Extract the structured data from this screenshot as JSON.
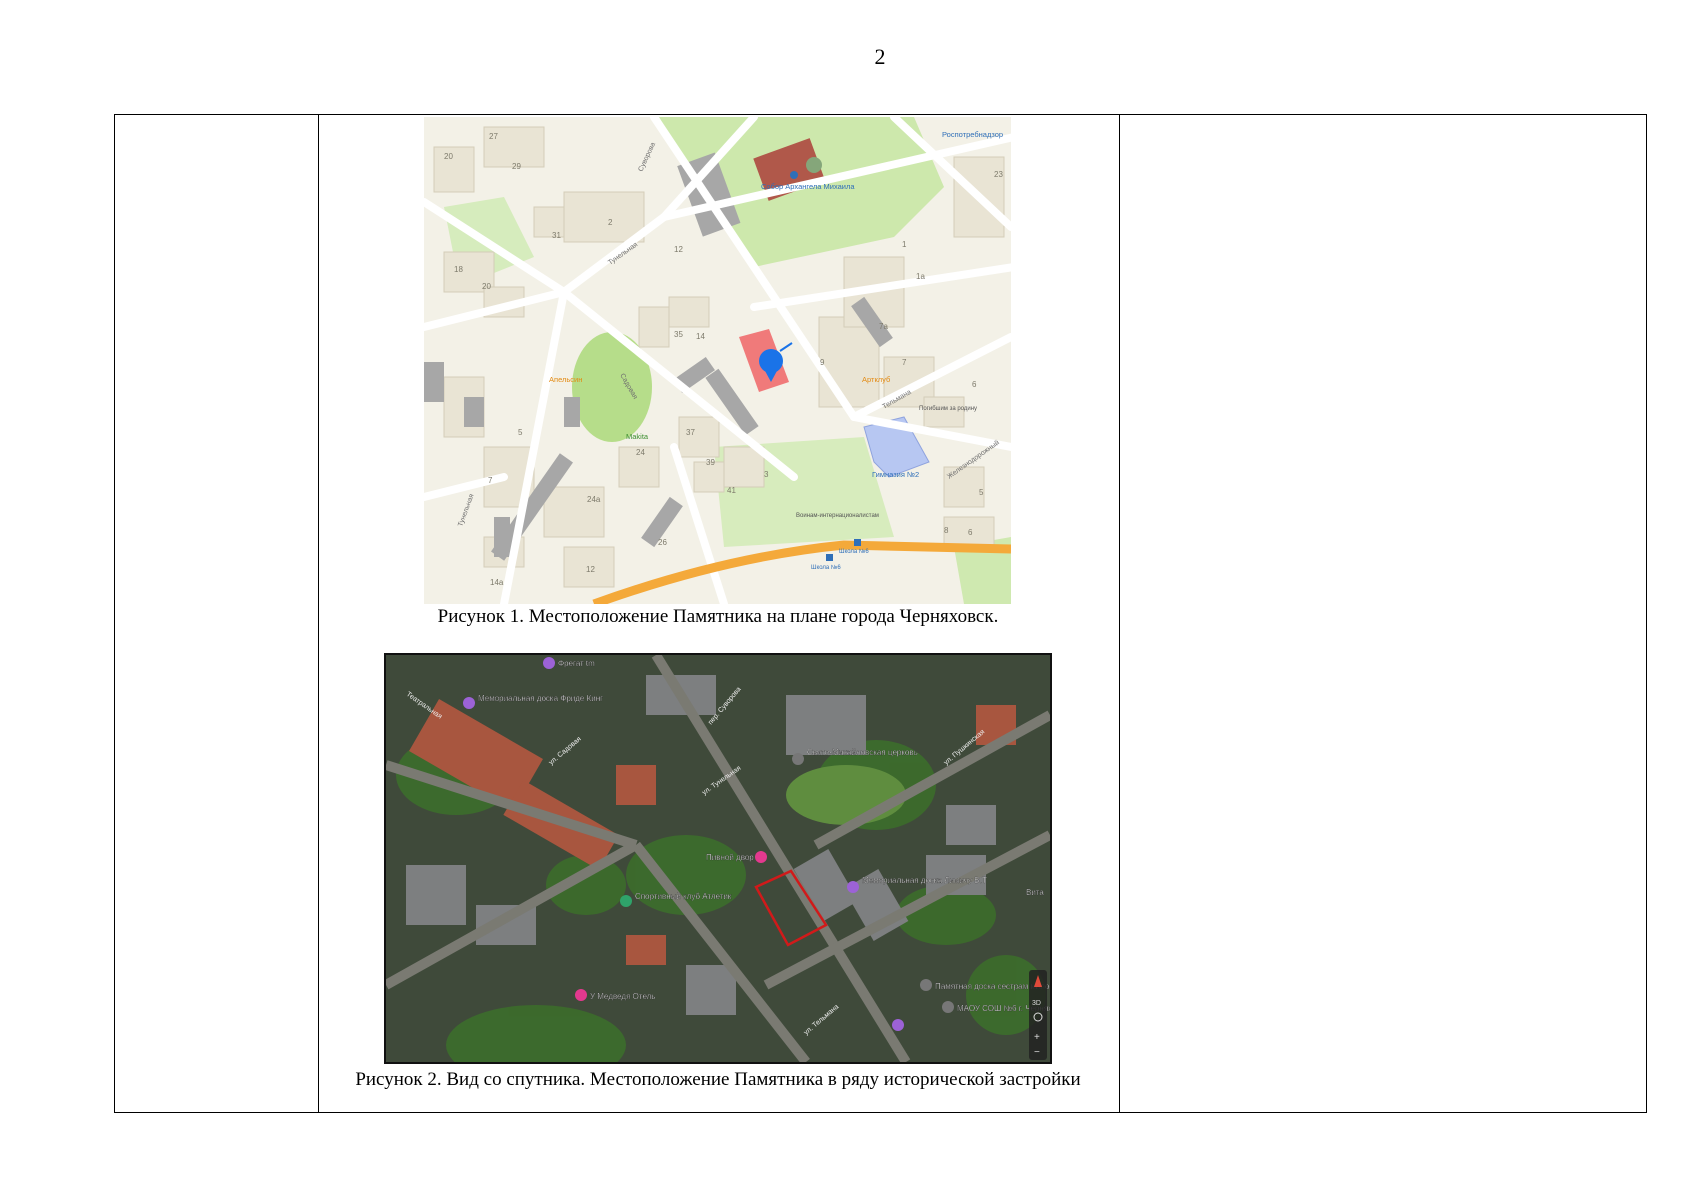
{
  "page": {
    "number": "2"
  },
  "figure1": {
    "caption": "Рисунок 1. Местоположение Памятника на плане города Черняховск.",
    "labels": {
      "cathedral": "Собор Архангела Михаила",
      "rospotreb": "Роспотребнадзор",
      "gymnasium": "Гимназия №2",
      "artclub": "Артклуб",
      "apelsin": "Апельсин",
      "makita": "Makita",
      "warriors": "Воинам-интернационалистам",
      "fallen": "Погибшим за родину",
      "school_stop": "Школа №6",
      "school_stop_2": "Школа №6"
    },
    "streets": {
      "suvorova": "Суворова",
      "tunnelnaya": "Тунельная",
      "sadovaya": "Садовая",
      "telmana": "Тельмана",
      "zheleznodorozhnaya": "Железнодорожный",
      "tunnelnaya_2": "Тунельная"
    },
    "house_numbers": [
      "27",
      "29",
      "20",
      "31",
      "2",
      "12",
      "18",
      "20",
      "35",
      "14",
      "9",
      "1",
      "1а",
      "7а",
      "7",
      "6",
      "37",
      "5",
      "39",
      "3",
      "24",
      "41",
      "24а",
      "7",
      "12",
      "14а",
      "8",
      "6",
      "5",
      "23",
      "26"
    ]
  },
  "figure2": {
    "caption": "Рисунок 2. Вид  со спутника. Местоположение Памятника в ряду исторической застройки",
    "labels": {
      "frigate": "Фрегат tm",
      "memorial_king": "Мемориальная доска Фриде Кинг",
      "church": "Свято-Михайловская церковь",
      "pub": "Пивной двор",
      "sport_club": "Спортивный клуб Атлетик",
      "memorial_lymichu": "Мемориальная доска Лимичу В.Т",
      "hotel": "У Медведя Отель",
      "memorial_sisters": "Памятная доска сестрам милосердия",
      "school": "МАОУ СОШ №6 г. Черняховск",
      "vita": "Вита"
    },
    "streets": {
      "teatralnaya": "Театральная",
      "sadovaya": "ул. Садовая",
      "suvorova": "пер. Суворова",
      "tunnelnaya": "ул. Тунельная",
      "telmana": "ул. Тельмана",
      "pushkinskaya": "ул. Пушкинская"
    },
    "controls": {
      "three_d": "3D",
      "zoom_in": "+",
      "zoom_out": "−"
    }
  },
  "colors": {
    "marker": "#1a73e8",
    "road_major": "#f4a93a",
    "parcel": "#f07a7a",
    "gymnasium": "#b7c7f2",
    "park": "#c9e6a8",
    "highlight": "#d11a1a"
  }
}
